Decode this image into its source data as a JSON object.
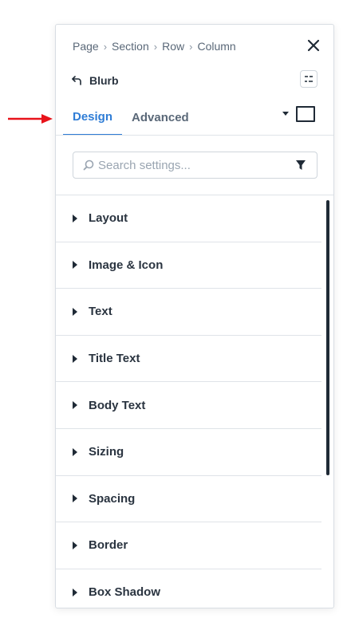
{
  "breadcrumb": [
    "Page",
    "Section",
    "Row",
    "Column"
  ],
  "module": {
    "title": "Blurb"
  },
  "tabs": [
    {
      "label": "Design",
      "active": true
    },
    {
      "label": "Advanced",
      "active": false
    }
  ],
  "search": {
    "placeholder": "Search settings..."
  },
  "groups": [
    "Layout",
    "Image & Icon",
    "Text",
    "Title Text",
    "Body Text",
    "Sizing",
    "Spacing",
    "Border",
    "Box Shadow"
  ],
  "colors": {
    "accent": "#2f7dd6",
    "annotation_arrow": "#e8131a",
    "text_dark": "#2a3440",
    "text_muted": "#5a6878"
  }
}
